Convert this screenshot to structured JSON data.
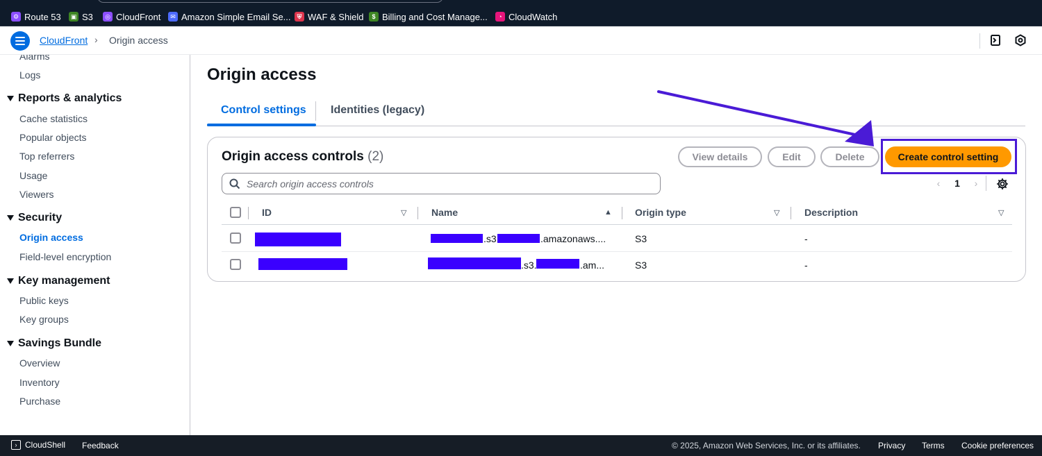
{
  "bookmarks": [
    {
      "label": "Route 53",
      "color": "#8c4fff"
    },
    {
      "label": "S3",
      "color": "#3f8624"
    },
    {
      "label": "CloudFront",
      "color": "#8c4fff"
    },
    {
      "label": "Amazon Simple Email Se...",
      "color": "#4d6bfe"
    },
    {
      "label": "WAF & Shield",
      "color": "#dd344c"
    },
    {
      "label": "Billing and Cost Manage...",
      "color": "#3f8624"
    },
    {
      "label": "CloudWatch",
      "color": "#e7157b"
    }
  ],
  "breadcrumb": {
    "service": "CloudFront",
    "separator": "›",
    "current": "Origin access"
  },
  "sidenav": {
    "items_top": [
      "Alarms",
      "Logs"
    ],
    "sections": [
      {
        "title": "Reports & analytics",
        "items": [
          "Cache statistics",
          "Popular objects",
          "Top referrers",
          "Usage",
          "Viewers"
        ]
      },
      {
        "title": "Security",
        "items": [
          "Origin access",
          "Field-level encryption"
        ],
        "active": "Origin access"
      },
      {
        "title": "Key management",
        "items": [
          "Public keys",
          "Key groups"
        ]
      },
      {
        "title": "Savings Bundle",
        "items": [
          "Overview",
          "Inventory",
          "Purchase"
        ]
      }
    ]
  },
  "page": {
    "title": "Origin access"
  },
  "tabs": [
    {
      "label": "Control settings",
      "active": true
    },
    {
      "label": "Identities (legacy)",
      "active": false
    }
  ],
  "panel": {
    "title": "Origin access controls",
    "count": "(2)",
    "buttons": {
      "view_details": "View details",
      "edit": "Edit",
      "delete": "Delete",
      "create": "Create control setting"
    },
    "search_placeholder": "Search origin access controls",
    "pagination": {
      "page": "1"
    },
    "columns": [
      "ID",
      "Name",
      "Origin type",
      "Description"
    ],
    "rows": [
      {
        "name_mid": ".s3.",
        "name_end": ".amazonaws....",
        "origin_type": "S3",
        "description": "-"
      },
      {
        "name_mid": ".s3.",
        "name_end": ".am...",
        "origin_type": "S3",
        "description": "-"
      }
    ]
  },
  "footer": {
    "cloudshell": "CloudShell",
    "feedback": "Feedback",
    "copyright": "© 2025, Amazon Web Services, Inc. or its affiliates.",
    "privacy": "Privacy",
    "terms": "Terms",
    "cookies": "Cookie preferences"
  },
  "colors": {
    "accent": "#006ce0",
    "primary_button": "#ff9900",
    "annotation": "#4a1bd6",
    "redaction": "#3a00ff"
  }
}
